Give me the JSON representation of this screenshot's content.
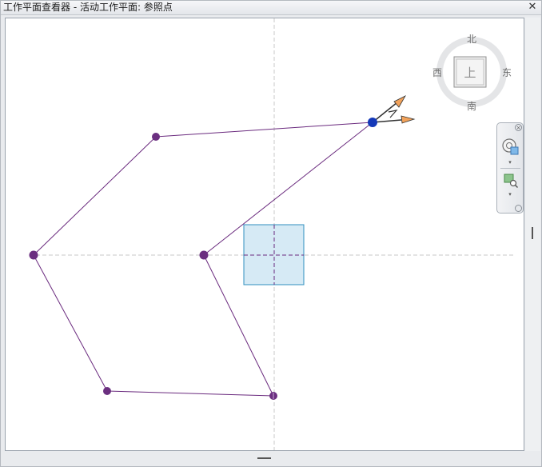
{
  "window": {
    "title": "工作平面查看器 - 活动工作平面: 参照点",
    "close_glyph": "✕"
  },
  "viewcube": {
    "face_label": "上",
    "compass": {
      "north": "北",
      "south": "南",
      "east": "东",
      "west": "西"
    }
  },
  "nav_bar": {
    "close_glyph": "×",
    "dropdown_glyph": "▾",
    "tools": [
      "full-navigation-wheel-icon",
      "zoom-region-icon"
    ]
  },
  "colors": {
    "sketch_line": "#6a2a7e",
    "sketch_point": "#6b2f80",
    "selected_point": "#1438b8",
    "workplane_fill": "#d6eaf5",
    "workplane_stroke": "#2f8fbf",
    "axis_arrow": "#f2a25a"
  }
}
